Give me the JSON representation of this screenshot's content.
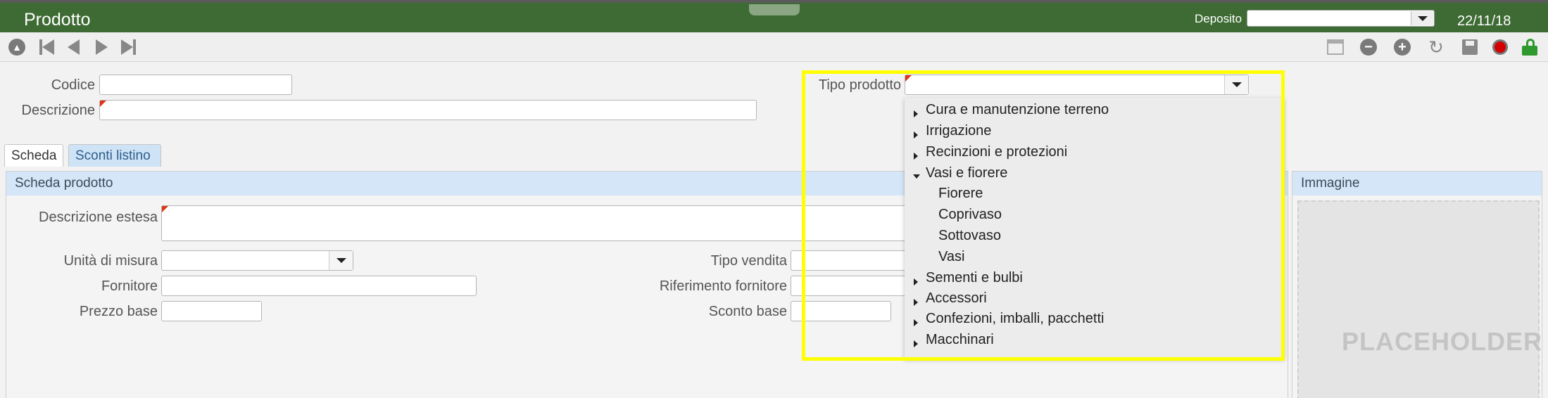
{
  "header": {
    "title": "Prodotto",
    "deposito_label": "Deposito",
    "deposito_value": "",
    "date": "22/11/18"
  },
  "toolbar": {
    "left": [
      "home-icon",
      "first-record-icon",
      "previous-record-icon",
      "next-record-icon",
      "last-record-icon"
    ],
    "right": [
      "archive-icon",
      "remove-icon",
      "add-icon",
      "refresh-icon",
      "save-icon",
      "record-icon",
      "unlock-icon"
    ]
  },
  "form": {
    "codice_label": "Codice",
    "codice_value": "",
    "descrizione_label": "Descrizione",
    "descrizione_value": "",
    "tipo_prodotto_label": "Tipo prodotto",
    "tipo_prodotto_value": ""
  },
  "tabs": [
    {
      "label": "Scheda"
    },
    {
      "label": "Sconti listino"
    }
  ],
  "scheda": {
    "title": "Scheda prodotto",
    "descrizione_estesa_label": "Descrizione estesa",
    "unita_label": "Unità di misura",
    "fornitore_label": "Fornitore",
    "prezzo_label": "Prezzo base",
    "tipo_vendita_label": "Tipo vendita",
    "rif_fornitore_label": "Riferimento fornitore",
    "sconto_label": "Sconto base"
  },
  "immagine": {
    "title": "Immagine",
    "placeholder": "PLACEHOLDER"
  },
  "tree": [
    {
      "label": "Cura e manutenzione terreno",
      "expanded": false,
      "level": 0
    },
    {
      "label": "Irrigazione",
      "expanded": false,
      "level": 0
    },
    {
      "label": "Recinzioni e protezioni",
      "expanded": false,
      "level": 0
    },
    {
      "label": "Vasi e fiorere",
      "expanded": true,
      "level": 0
    },
    {
      "label": "Fiorere",
      "level": 1
    },
    {
      "label": "Coprivaso",
      "level": 1
    },
    {
      "label": "Sottovaso",
      "level": 1
    },
    {
      "label": "Vasi",
      "level": 1
    },
    {
      "label": "Sementi e bulbi",
      "expanded": false,
      "level": 0
    },
    {
      "label": "Accessori",
      "expanded": false,
      "level": 0
    },
    {
      "label": "Confezioni, imballi, pacchetti",
      "expanded": false,
      "level": 0
    },
    {
      "label": "Macchinari",
      "expanded": false,
      "level": 0
    }
  ],
  "colors": {
    "header": "#3e6b34",
    "highlight": "#ffff00",
    "required_marker": "#e0341a"
  }
}
